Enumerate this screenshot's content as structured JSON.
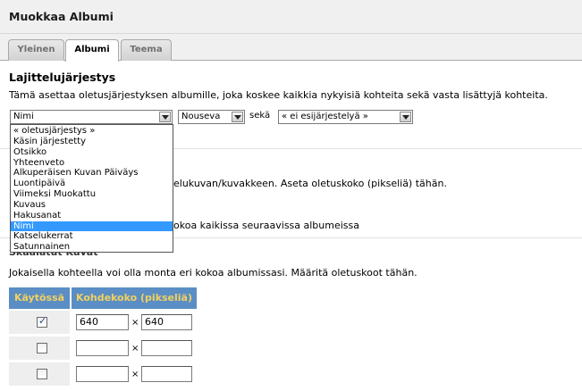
{
  "header": {
    "title": "Muokkaa Albumi"
  },
  "tabs": [
    {
      "label": "Yleinen",
      "active": false
    },
    {
      "label": "Albumi",
      "active": true
    },
    {
      "label": "Teema",
      "active": false
    }
  ],
  "sort": {
    "title": "Lajittelujärjestys",
    "description": "Tämä asettaa oletusjärjestyksen albumille, joka koskee kaikkia nykyisiä kohteita sekä vasta lisättyjä kohteita.",
    "order_by_value": "Nimi",
    "direction_value": "Nouseva",
    "and_label": "sekä",
    "secondary_value": "« ei esijärjestelyä »",
    "options": [
      "« oletusjärjestys »",
      "Käsin järjestetty",
      "Otsikko",
      "Yhteenveto",
      "Alkuperäisen Kuvan Päiväys",
      "Luontipäivä",
      "Viimeksi Muokattu",
      "Kuvaus",
      "Hakusanat",
      "Nimi",
      "Katselukerrat",
      "Satunnainen"
    ],
    "selected_option": "Nimi"
  },
  "thumbnail": {
    "description_partial": "elukuvan/kuvakkeen. Aseta oletuskoko (pikseliä) tähän.",
    "apply_text_partial": "okoa kaikissa seuraavissa albumeissa"
  },
  "resized": {
    "title_partial": "Skaalatut Kuvat",
    "description": "Jokaisella kohteella voi olla monta eri kokoa albumissasi. Määritä oletuskoot tähän.",
    "col_enabled": "Käytössä",
    "col_size": "Kohdekoko (pikseliä)",
    "times": "×",
    "rows": [
      {
        "enabled": true,
        "width": "640",
        "height": "640"
      },
      {
        "enabled": false,
        "width": "",
        "height": ""
      },
      {
        "enabled": false,
        "width": "",
        "height": ""
      }
    ]
  }
}
